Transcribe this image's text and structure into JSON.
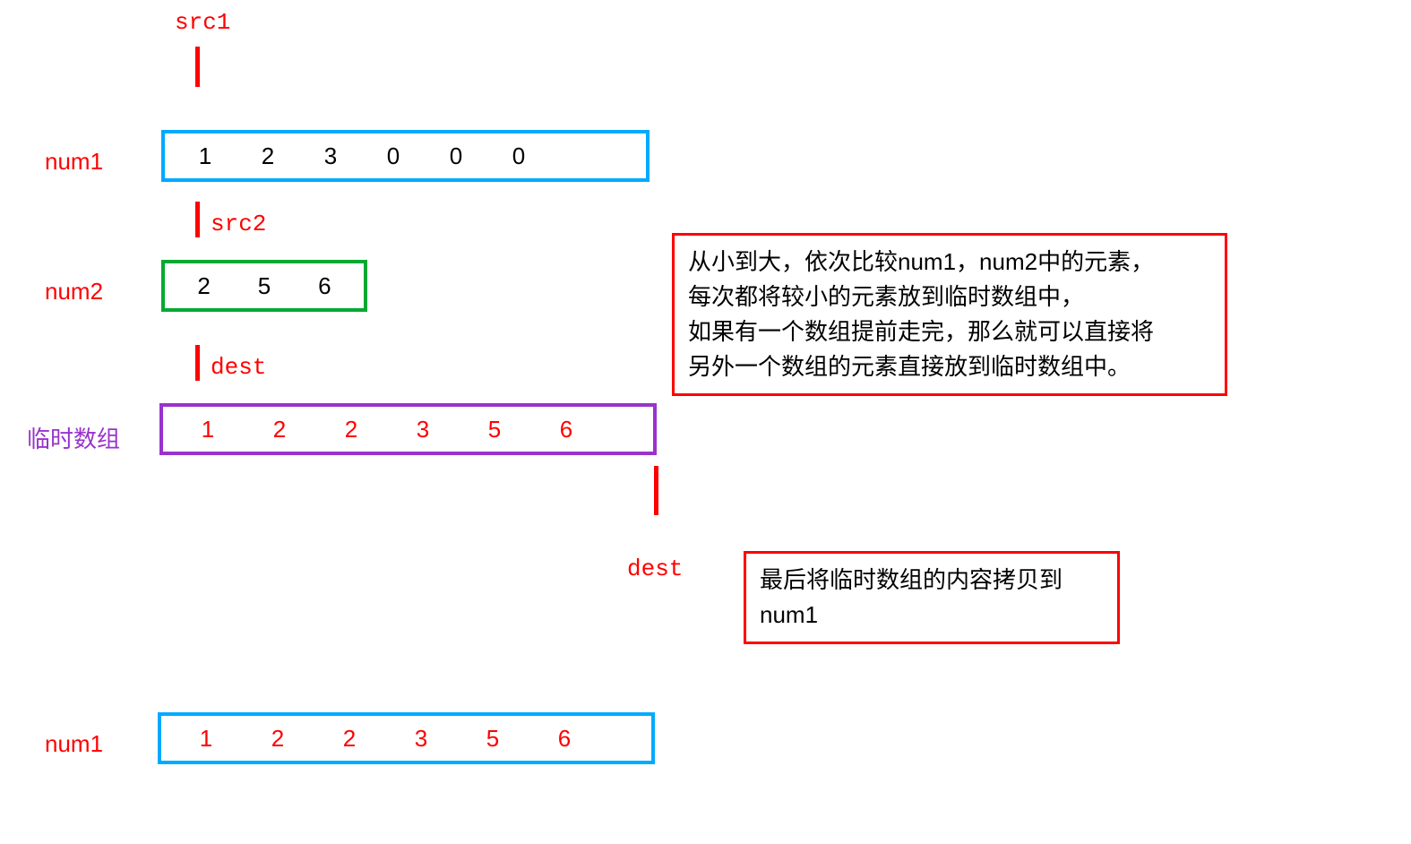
{
  "pointers": {
    "src1": "src1",
    "src2": "src2",
    "dest_top": "dest",
    "dest_bottom": "dest"
  },
  "labels": {
    "num1_top": "num1",
    "num2": "num2",
    "temp_array": "临时数组",
    "num1_bottom": "num1"
  },
  "arrays": {
    "num1_top": [
      "1",
      "2",
      "3",
      "0",
      "0",
      "0"
    ],
    "num2": [
      "2",
      "5",
      "6"
    ],
    "temp": [
      "1",
      "2",
      "2",
      "3",
      "5",
      "6"
    ],
    "num1_bottom": [
      "1",
      "2",
      "2",
      "3",
      "5",
      "6"
    ]
  },
  "explanation": {
    "box1_line1": "从小到大，依次比较num1，num2中的元素，",
    "box1_line2": "每次都将较小的元素放到临时数组中，",
    "box1_line3": "如果有一个数组提前走完，那么就可以直接将",
    "box1_line4": "另外一个数组的元素直接放到临时数组中。",
    "box2": "最后将临时数组的内容拷贝到num1"
  }
}
